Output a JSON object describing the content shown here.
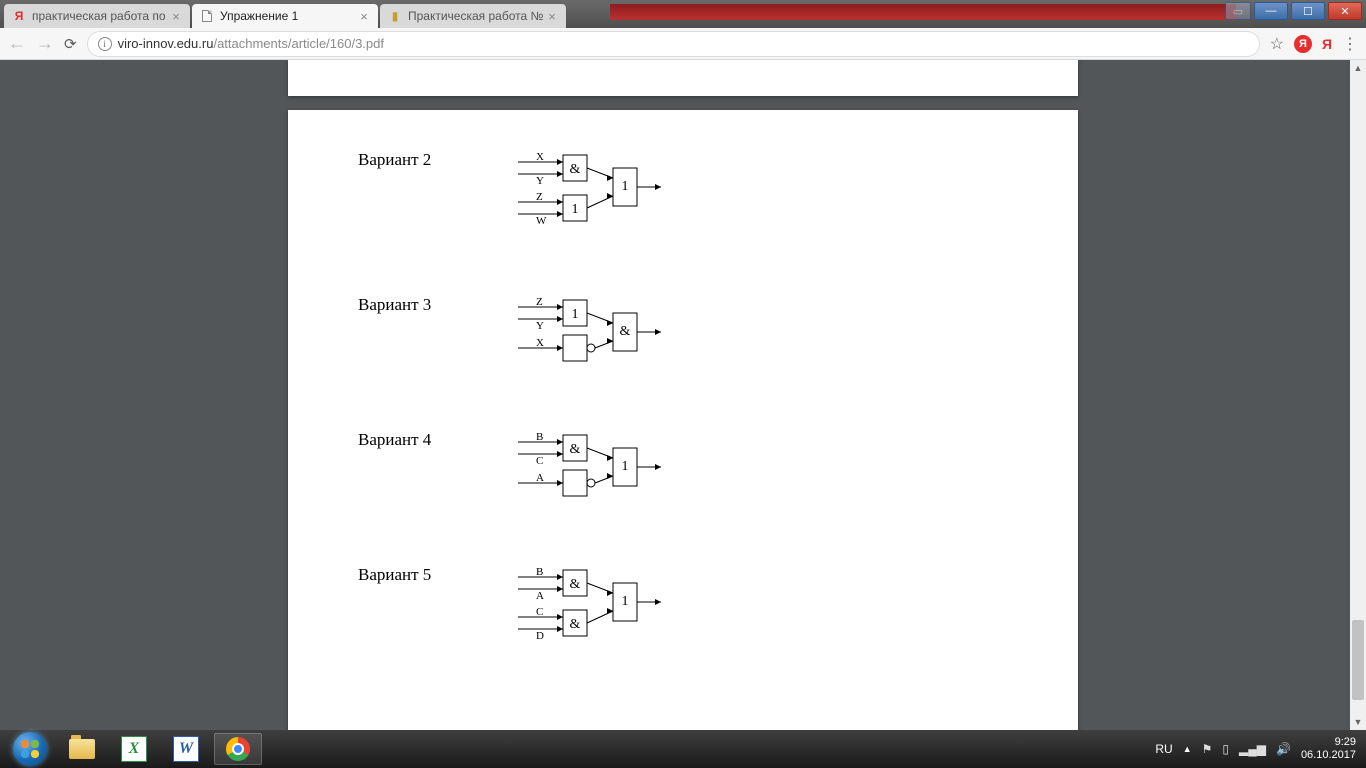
{
  "tabs": [
    {
      "title": "практическая работа по",
      "active": false,
      "fav": "ya"
    },
    {
      "title": "Упражнение 1",
      "active": true,
      "fav": "doc"
    },
    {
      "title": "Практическая работа №",
      "active": false,
      "fav": "bar"
    }
  ],
  "url": {
    "host": "viro-innov.edu.ru",
    "path": "/attachments/article/160/3.pdf"
  },
  "variants": [
    {
      "title": "Вариант 2",
      "circuit": {
        "inputs_top": [
          "X",
          "Y"
        ],
        "gate_top": "&",
        "inputs_bottom": [
          "Z",
          "W"
        ],
        "gate_bottom": "1",
        "gate_bottom_invert": false,
        "gate_out": "1"
      }
    },
    {
      "title": "Вариант 3",
      "circuit": {
        "inputs_top": [
          "Z",
          "Y"
        ],
        "gate_top": "1",
        "inputs_bottom": [
          "X"
        ],
        "gate_bottom": "",
        "gate_bottom_invert": true,
        "gate_out": "&"
      }
    },
    {
      "title": "Вариант 4",
      "circuit": {
        "inputs_top": [
          "B",
          "C"
        ],
        "gate_top": "&",
        "inputs_bottom": [
          "A"
        ],
        "gate_bottom": "",
        "gate_bottom_invert": true,
        "gate_out": "1"
      }
    },
    {
      "title": "Вариант 5",
      "circuit": {
        "inputs_top": [
          "B",
          "A"
        ],
        "gate_top": "&",
        "inputs_bottom": [
          "C",
          "D"
        ],
        "gate_bottom": "&",
        "gate_bottom_invert": false,
        "gate_out": "1"
      }
    }
  ],
  "tray": {
    "lang": "RU",
    "time": "9:29",
    "date": "06.10.2017"
  },
  "icons": {
    "excel": "X",
    "word": "W"
  }
}
